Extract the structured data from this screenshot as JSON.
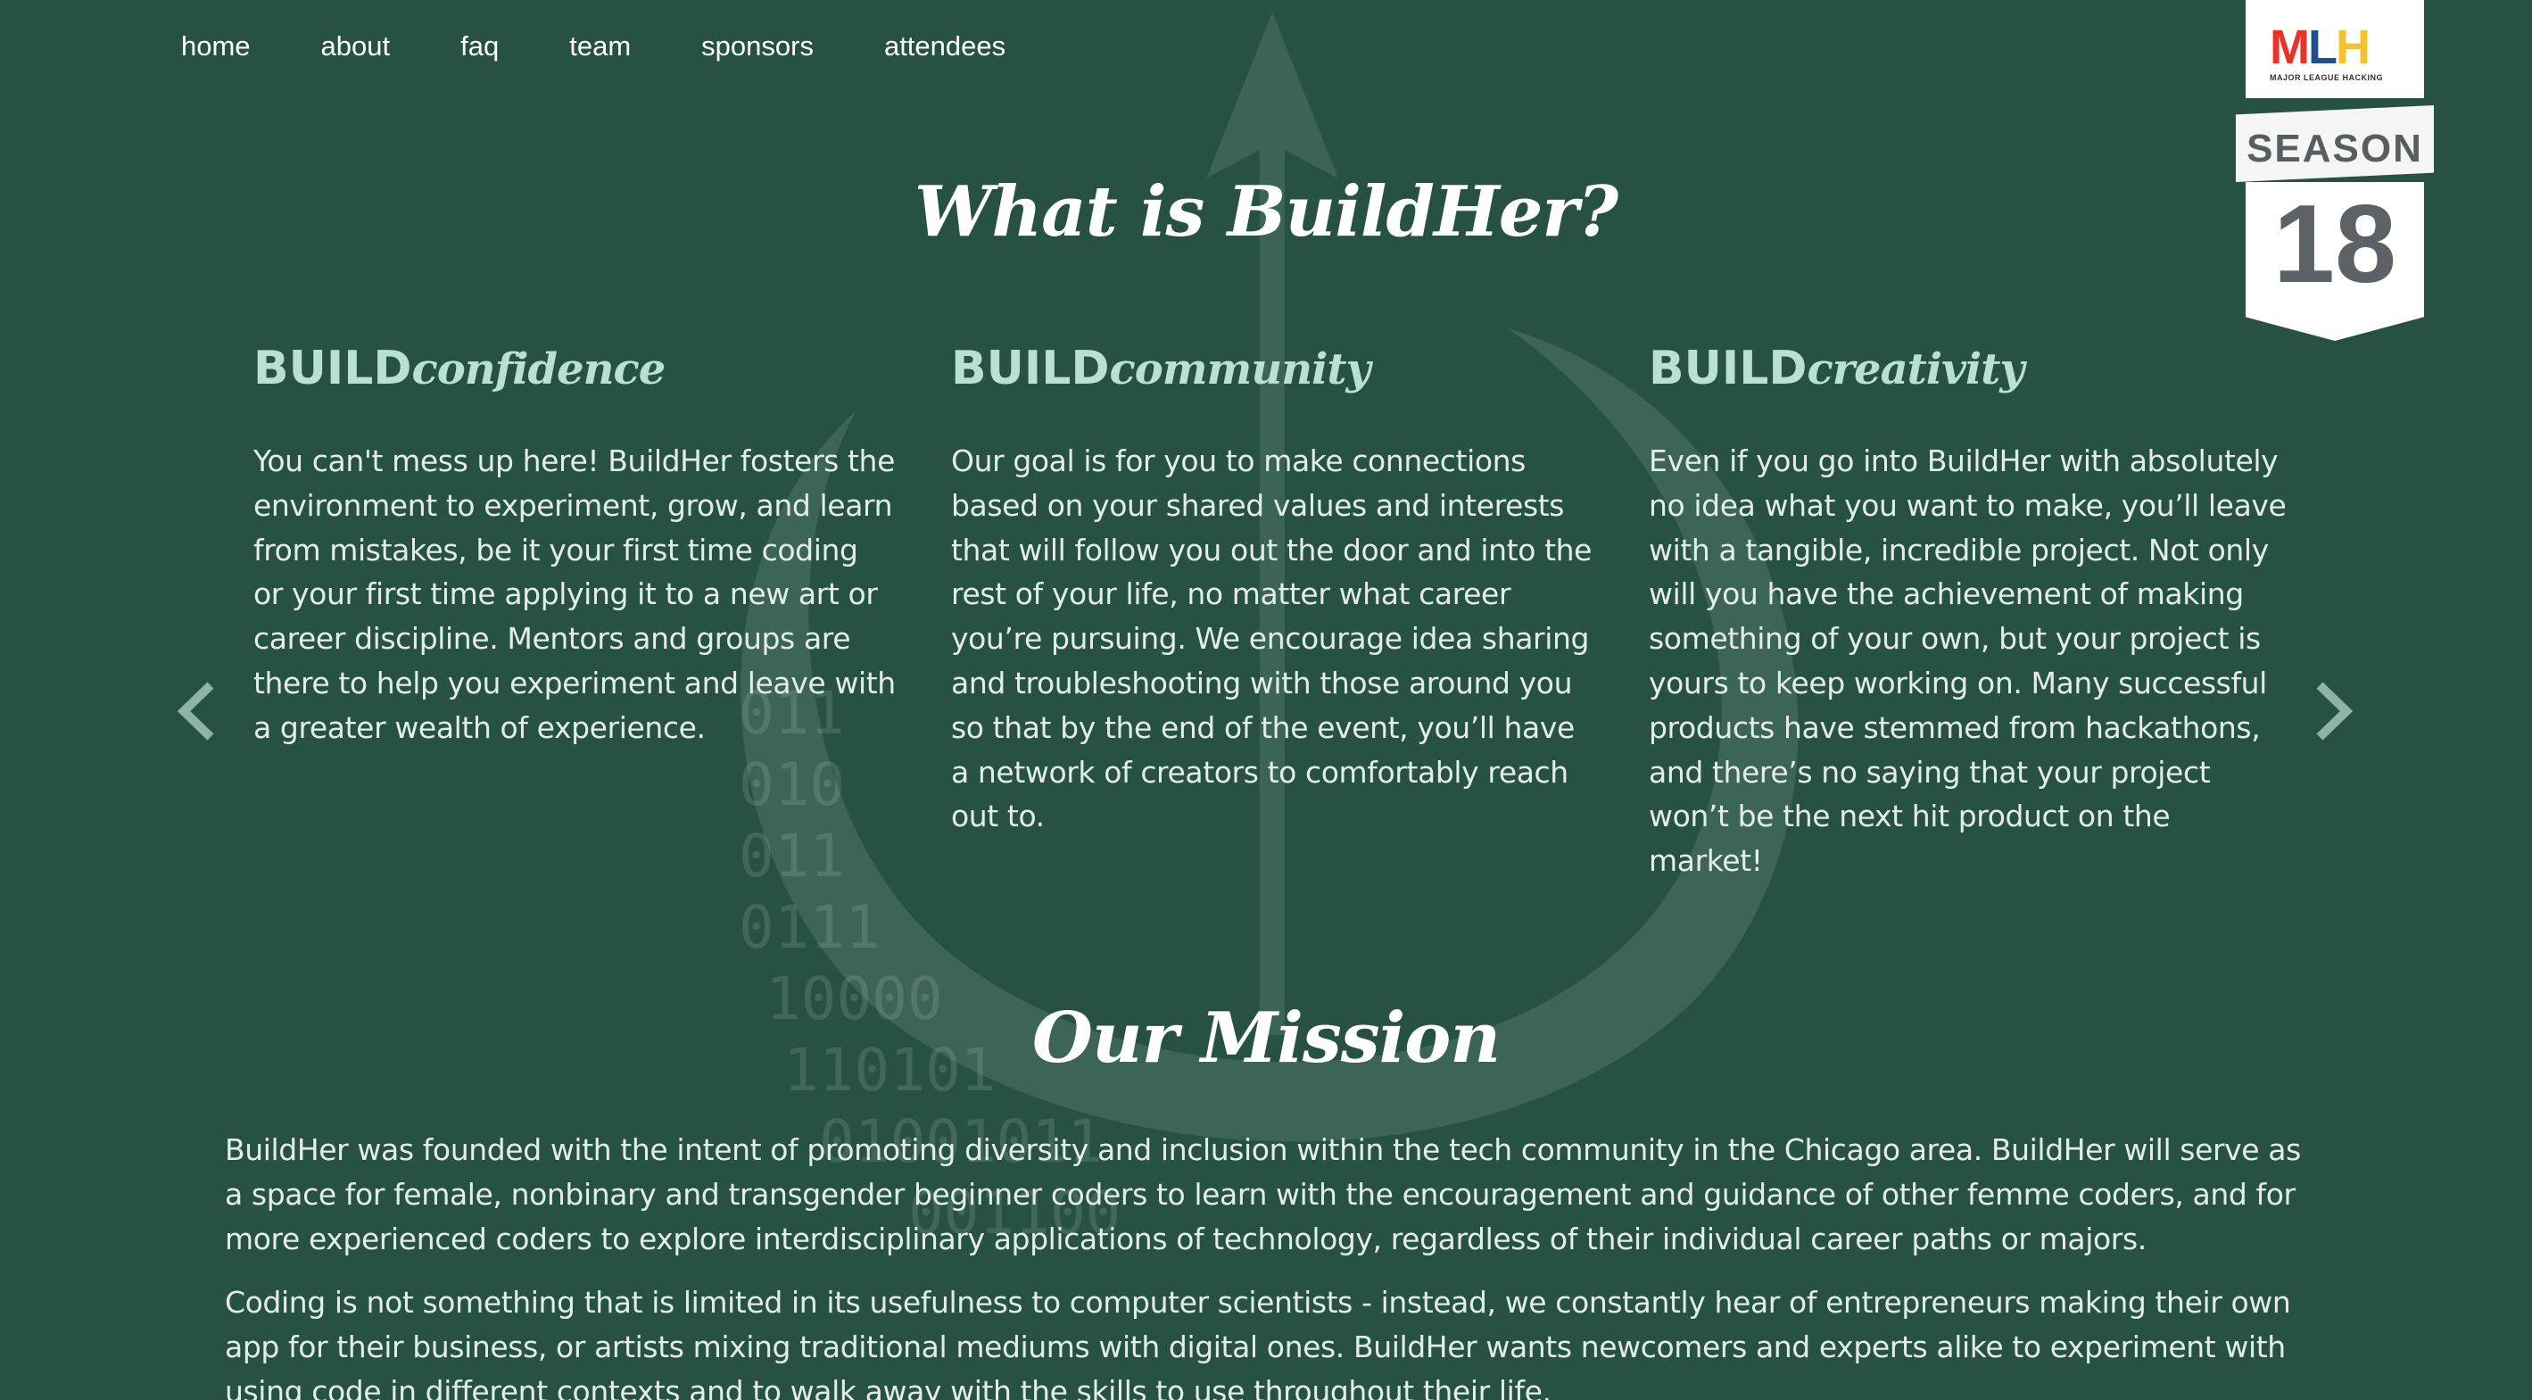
{
  "nav": {
    "items": [
      "home",
      "about",
      "faq",
      "team",
      "sponsors",
      "attendees"
    ]
  },
  "badge": {
    "logo_text": "MLH",
    "logo_sub": "MAJOR LEAGUE HACKING",
    "season_label": "SEASON",
    "season_number": "18"
  },
  "about": {
    "heading": "What is BuildHer?",
    "columns": [
      {
        "title_strong": "BUILD",
        "title_soft": "confidence",
        "text": "You can't mess up here! BuildHer fosters the environment to experiment, grow, and learn from mistakes, be it your first time coding or your first time applying it to a new art or career discipline. Mentors and groups are there to help you experiment and leave with a greater wealth of experience."
      },
      {
        "title_strong": "BUILD",
        "title_soft": "community",
        "text": "Our goal is for you to make connections based on your shared values and interests that will follow you out the door and into the rest of your life, no matter what career you’re pursuing. We encourage idea sharing and troubleshooting with those around you so that by the end of the event, you’ll have a network of creators to comfortably reach out to."
      },
      {
        "title_strong": "BUILD",
        "title_soft": "creativity",
        "text": "Even if you go into BuildHer with absolutely no idea what you want to make, you’ll leave with a tangible, incredible project. Not only will you have the achievement of making something of your own, but your project is yours to keep working on. Many successful products have stemmed from hackathons, and there’s no saying that your project won’t be the next hit product on the market!"
      }
    ]
  },
  "mission": {
    "heading": "Our Mission",
    "paragraphs": [
      "BuildHer was founded with the intent of promoting diversity and inclusion within the tech community in the Chicago area. BuildHer will serve as a space for female, nonbinary and transgender beginner coders to learn with the encouragement and guidance of other femme coders, and for more experienced coders to explore interdisciplinary applications of technology, regardless of their individual career paths or majors.",
      "Coding is not something that is limited in its usefulness to computer scientists - instead, we constantly hear of entrepreneurs making their own app for their business, or artists mixing traditional mediums with digital ones. BuildHer wants newcomers and experts alike to experiment with using code in different contexts and to walk away with the skills to use throughout their life."
    ]
  },
  "background_binary": [
    "011",
    "010",
    "011",
    "0111",
    "10000",
    "110101",
    "01001011",
    "001100"
  ],
  "icons": {
    "arrow_left": "chevron-left-icon",
    "arrow_right": "chevron-right-icon"
  },
  "colors": {
    "background": "#275243",
    "accent": "#b8e1d3",
    "text": "#e3ede8"
  }
}
